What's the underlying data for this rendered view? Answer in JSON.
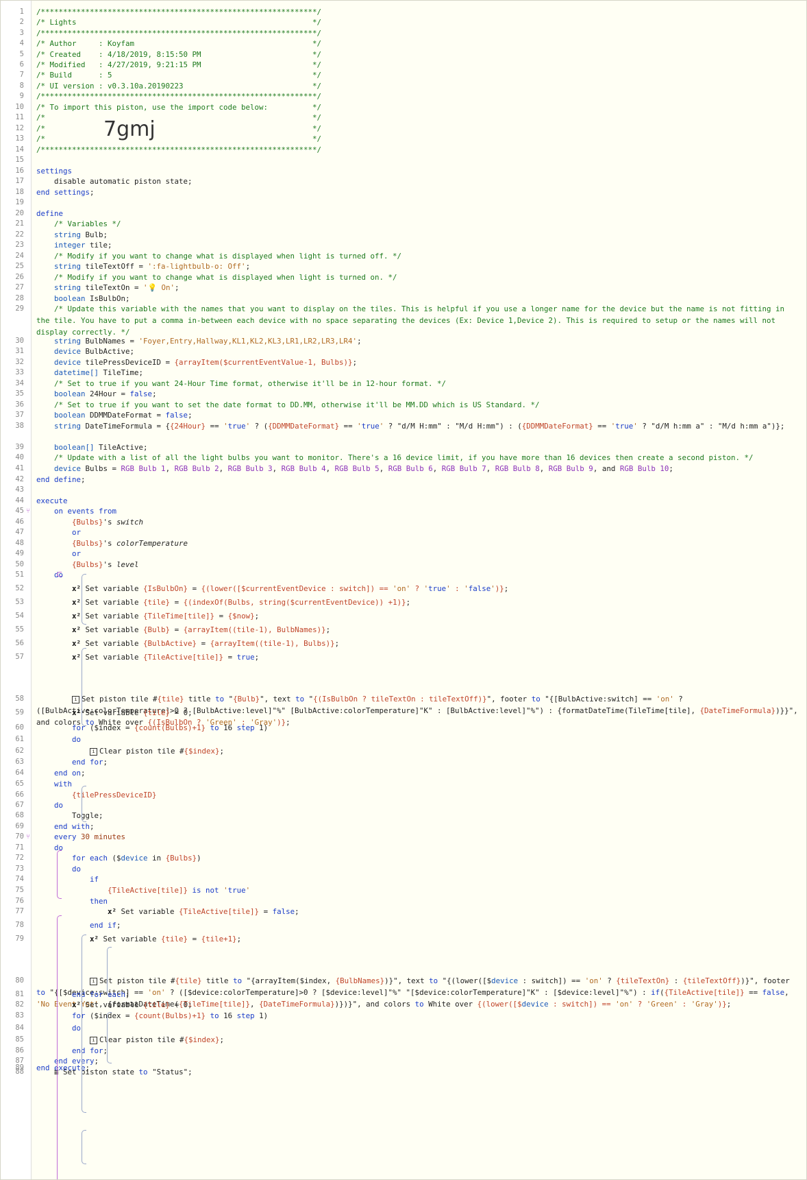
{
  "editor": {
    "import_code": "7gmj",
    "lines": [
      {
        "n": "1",
        "t": "/**************************************************************/"
      },
      {
        "n": "2",
        "t": "/* Lights                                                     */"
      },
      {
        "n": "3",
        "t": "/**************************************************************/"
      },
      {
        "n": "4",
        "t": "/* Author     : Koyfam                                        */"
      },
      {
        "n": "5",
        "t": "/* Created    : 4/18/2019, 8:15:50 PM                         */"
      },
      {
        "n": "6",
        "t": "/* Modified   : 4/27/2019, 9:21:15 PM                         */"
      },
      {
        "n": "7",
        "t": "/* Build      : 5                                             */"
      },
      {
        "n": "8",
        "t": "/* UI version : v0.3.10a.20190223                             */"
      },
      {
        "n": "9",
        "t": "/**************************************************************/"
      },
      {
        "n": "10",
        "t": "/* To import this piston, use the import code below:          */"
      },
      {
        "n": "11",
        "t": "/*                                                            */"
      },
      {
        "n": "12",
        "t": "/*                                                            */"
      },
      {
        "n": "13",
        "t": "/*                                                            */"
      },
      {
        "n": "14",
        "t": "/**************************************************************/"
      },
      {
        "n": "15",
        "t": ""
      },
      {
        "n": "16",
        "t": "settings"
      },
      {
        "n": "17",
        "t": "    disable automatic piston state;"
      },
      {
        "n": "18",
        "t": "end settings;"
      },
      {
        "n": "19",
        "t": ""
      },
      {
        "n": "20",
        "t": "define"
      },
      {
        "n": "21",
        "t": "    /* Variables */"
      },
      {
        "n": "22",
        "t": "    string Bulb;"
      },
      {
        "n": "23",
        "t": "    integer tile;"
      },
      {
        "n": "24",
        "t": "    /* Modify if you want to change what is displayed when light is turned off. */"
      },
      {
        "n": "25",
        "t": "    string tileTextOff = ':fa-lightbulb-o: Off';"
      },
      {
        "n": "26",
        "t": "    /* Modify if you want to change what is displayed when light is turned on. */"
      },
      {
        "n": "27",
        "t": "    string tileTextOn = '💡 On';"
      },
      {
        "n": "28",
        "t": "    boolean IsBulbOn;"
      },
      {
        "n": "29",
        "t": "    /* Update this variable with the names that you want to display on the tiles. This is helpful if you use a longer name for the device but the name is not fitting in the tile. You have to put a comma in-between each device with no space separating the devices (Ex: Device 1,Device 2). This is required to setup or the names will not display correctly. */"
      },
      {
        "n": "30",
        "t": "    string BulbNames = 'Foyer,Entry,Hallway,KL1,KL2,KL3,LR1,LR2,LR3,LR4';"
      },
      {
        "n": "31",
        "t": "    device BulbActive;"
      },
      {
        "n": "32",
        "t": "    device tilePressDeviceID = {arrayItem($currentEventValue-1, Bulbs)};"
      },
      {
        "n": "33",
        "t": "    datetime[] TileTime;"
      },
      {
        "n": "34",
        "t": "    /* Set to true if you want 24-Hour Time format, otherwise it'll be in 12-hour format. */"
      },
      {
        "n": "35",
        "t": "    boolean 24Hour = false;"
      },
      {
        "n": "36",
        "t": "    /* Set to true if you want to set the date format to DD.MM, otherwise it'll be MM.DD which is US Standard. */"
      },
      {
        "n": "37",
        "t": "    boolean DDMMDateFormat = false;"
      },
      {
        "n": "38",
        "t": "    string DateTimeFormula = {{24Hour} == 'true' ? ({DDMMDateFormat} == 'true' ? \"d/M H:mm\" : \"M/d H:mm\") : ({DDMMDateFormat} == 'true' ? \"d/M h:mm a\" : \"M/d h:mm a\")};"
      },
      {
        "n": "39",
        "t": "    boolean[] TileActive;"
      },
      {
        "n": "40",
        "t": "    /* Update with a list of all the light bulbs you want to monitor. There's a 16 device limit, if you have more than 16 devices then create a second piston. */"
      },
      {
        "n": "41",
        "t": "    device Bulbs = RGB Bulb 1, RGB Bulb 2, RGB Bulb 3, RGB Bulb 4, RGB Bulb 5, RGB Bulb 6, RGB Bulb 7, RGB Bulb 8, RGB Bulb 9, and RGB Bulb 10;"
      },
      {
        "n": "42",
        "t": "end define;"
      },
      {
        "n": "43",
        "t": ""
      },
      {
        "n": "44",
        "t": "execute"
      },
      {
        "n": "45",
        "t": "    on events from"
      },
      {
        "n": "46",
        "t": "        {Bulbs}'s switch"
      },
      {
        "n": "47",
        "t": "        or"
      },
      {
        "n": "48",
        "t": "        {Bulbs}'s colorTemperature"
      },
      {
        "n": "49",
        "t": "        or"
      },
      {
        "n": "50",
        "t": "        {Bulbs}'s level"
      },
      {
        "n": "51",
        "t": "    do"
      },
      {
        "n": "52",
        "t": "        x² Set variable {IsBulbOn} = {(lower([$currentEventDevice : switch]) == 'on' ? 'true' : 'false')};"
      },
      {
        "n": "53",
        "t": "        x² Set variable {tile} = {(indexOf(Bulbs, string($currentEventDevice)) +1)};"
      },
      {
        "n": "54",
        "t": "        x² Set variable {TileTime[tile]} = {$now};"
      },
      {
        "n": "55",
        "t": "        x² Set variable {Bulb} = {arrayItem((tile-1), BulbNames)};"
      },
      {
        "n": "56",
        "t": "        x² Set variable {BulbActive} = {arrayItem((tile-1), Bulbs)};"
      },
      {
        "n": "57",
        "t": "        x² Set variable {TileActive[tile]} = true;"
      },
      {
        "n": "58",
        "t": "        Set piston tile #{tile} title to \"{Bulb}\", text to \"{(IsBulbOn ? tileTextOn : tileTextOff)}\", footer to \"{[BulbActive:switch] == 'on' ? ([BulbActive:colorTemperature]>0 ? [BulbActive:level]\"%\" [BulbActive:colorTemperature]\"K\" : [BulbActive:level]\"%\") : {formatDateTime(TileTime[tile], {DateTimeFormula})}}\", and colors to White over {(IsBulbOn ? 'Green' : 'Gray')};"
      },
      {
        "n": "59",
        "t": "        x² Set variable {tile} = 0;"
      },
      {
        "n": "60",
        "t": "        for ($index = {count(Bulbs)+1} to 16 step 1)"
      },
      {
        "n": "61",
        "t": "        do"
      },
      {
        "n": "62",
        "t": "            Clear piston tile #{$index};"
      },
      {
        "n": "63",
        "t": "        end for;"
      },
      {
        "n": "64",
        "t": "    end on;"
      },
      {
        "n": "65",
        "t": "    with"
      },
      {
        "n": "66",
        "t": "        {tilePressDeviceID}"
      },
      {
        "n": "67",
        "t": "    do"
      },
      {
        "n": "68",
        "t": "        Toggle;"
      },
      {
        "n": "69",
        "t": "    end with;"
      },
      {
        "n": "70",
        "t": "    every 30 minutes"
      },
      {
        "n": "71",
        "t": "    do"
      },
      {
        "n": "72",
        "t": "        for each ($device in {Bulbs})"
      },
      {
        "n": "73",
        "t": "        do"
      },
      {
        "n": "74",
        "t": "            if"
      },
      {
        "n": "75",
        "t": "                {TileActive[tile]} is not 'true'"
      },
      {
        "n": "76",
        "t": "            then"
      },
      {
        "n": "77",
        "t": "                x² Set variable {TileActive[tile]} = false;"
      },
      {
        "n": "78",
        "t": "            end if;"
      },
      {
        "n": "79",
        "t": "            x² Set variable {tile} = {tile+1};"
      },
      {
        "n": "80",
        "t": "            Set piston tile #{tile} title to \"{arrayItem($index, {BulbNames})}\", text to \"{(lower([$device : switch]) == 'on' ? {tileTextOn} : {tileTextOff})}\", footer to \"{[$device:switch] == 'on' ? ([$device:colorTemperature]>0 ? [$device:level]\"%\" \"[$device:colorTemperature]\"K\" : [$device:level]\"%\") : if({TileActive[tile]} == false, 'No Event Yet', {formatDateTime({TileTime[tile]}, {DateTimeFormula})})}\", and colors to White over {(lower([$device : switch]) == 'on' ? 'Green' : 'Gray')};"
      },
      {
        "n": "81",
        "t": "        end for each;"
      },
      {
        "n": "82",
        "t": "        x² Set variable {tile} = 0;"
      },
      {
        "n": "83",
        "t": "        for ($index = {count(Bulbs)+1} to 16 step 1)"
      },
      {
        "n": "84",
        "t": "        do"
      },
      {
        "n": "85",
        "t": "            Clear piston tile #{$index};"
      },
      {
        "n": "86",
        "t": "        end for;"
      },
      {
        "n": "87",
        "t": "    end every;"
      },
      {
        "n": "88",
        "t": "    Set piston state to \"Status\";"
      },
      {
        "n": "89",
        "t": "end execute;"
      }
    ]
  }
}
